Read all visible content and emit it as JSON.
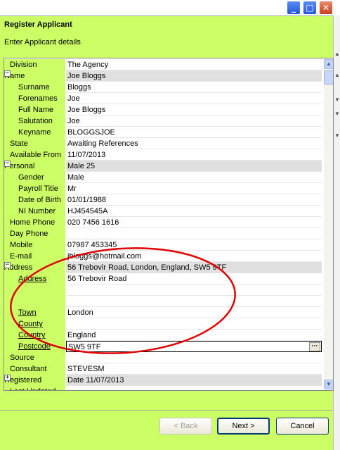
{
  "window": {
    "title": "Register Applicant",
    "subtitle": "Enter Applicant details",
    "title_buttons": {
      "minimize": "_",
      "maximize": "□",
      "close": "✕"
    }
  },
  "grid": {
    "rows": [
      {
        "label": "Division",
        "value": "The Agency",
        "type": "top"
      },
      {
        "label": "Name",
        "value": "Joe Bloggs",
        "type": "cat",
        "expander": "−"
      },
      {
        "label": "Surname",
        "value": "Bloggs",
        "type": "child"
      },
      {
        "label": "Forenames",
        "value": "Joe",
        "type": "child"
      },
      {
        "label": "Full Name",
        "value": "Joe Bloggs",
        "type": "child"
      },
      {
        "label": "Salutation",
        "value": "Joe",
        "type": "child"
      },
      {
        "label": "Keyname",
        "value": "BLOGGSJOE",
        "type": "child"
      },
      {
        "label": "State",
        "value": "Awaiting References",
        "type": "top"
      },
      {
        "label": "Available From",
        "value": "11/07/2013",
        "type": "top"
      },
      {
        "label": "Personal",
        "value": "Male 25",
        "type": "cat",
        "expander": "−"
      },
      {
        "label": "Gender",
        "value": "Male",
        "type": "child"
      },
      {
        "label": "Payroll Title",
        "value": "Mr",
        "type": "child"
      },
      {
        "label": "Date of Birth",
        "value": "01/01/1988",
        "type": "child"
      },
      {
        "label": "NI Number",
        "value": "HJ454545A",
        "type": "child"
      },
      {
        "label": "Home Phone",
        "value": "020 7456 1616",
        "type": "top"
      },
      {
        "label": "Day Phone",
        "value": "",
        "type": "top"
      },
      {
        "label": "Mobile",
        "value": "07987 453345",
        "type": "top"
      },
      {
        "label": "E-mail",
        "value": "jbloggs@hotmail.com",
        "type": "top"
      },
      {
        "label": "Address",
        "value": "56 Trebovir Road, London, England, SW5 9TF",
        "type": "cat",
        "expander": "−"
      },
      {
        "label": "Address",
        "value": "56 Trebovir Road",
        "type": "child",
        "underline_first": true
      },
      {
        "label": "",
        "value": "",
        "type": "child"
      },
      {
        "label": "",
        "value": "",
        "type": "child"
      },
      {
        "label": "Town",
        "value": "London",
        "type": "child",
        "underline_first": true
      },
      {
        "label": "County",
        "value": "",
        "type": "child",
        "underline_first": true
      },
      {
        "label": "Country",
        "value": "England",
        "type": "child",
        "underline_first": true
      },
      {
        "label": "Postcode",
        "value": "SW5 9TF",
        "type": "child",
        "underline_first": true,
        "selected": true,
        "ellipsis": "···"
      },
      {
        "label": "Source",
        "value": "",
        "type": "top"
      },
      {
        "label": "Consultant",
        "value": "STEVESM",
        "type": "top"
      },
      {
        "label": "Registered",
        "value": "Date 11/07/2013",
        "type": "cat",
        "expander": "+"
      },
      {
        "label": "Last Updated",
        "value": "",
        "type": "top"
      }
    ]
  },
  "buttons": {
    "back": "< Back",
    "next": "Next >",
    "cancel": "Cancel"
  },
  "colors": {
    "accent_green": "#ccff66",
    "annotation_red": "#e00000"
  }
}
